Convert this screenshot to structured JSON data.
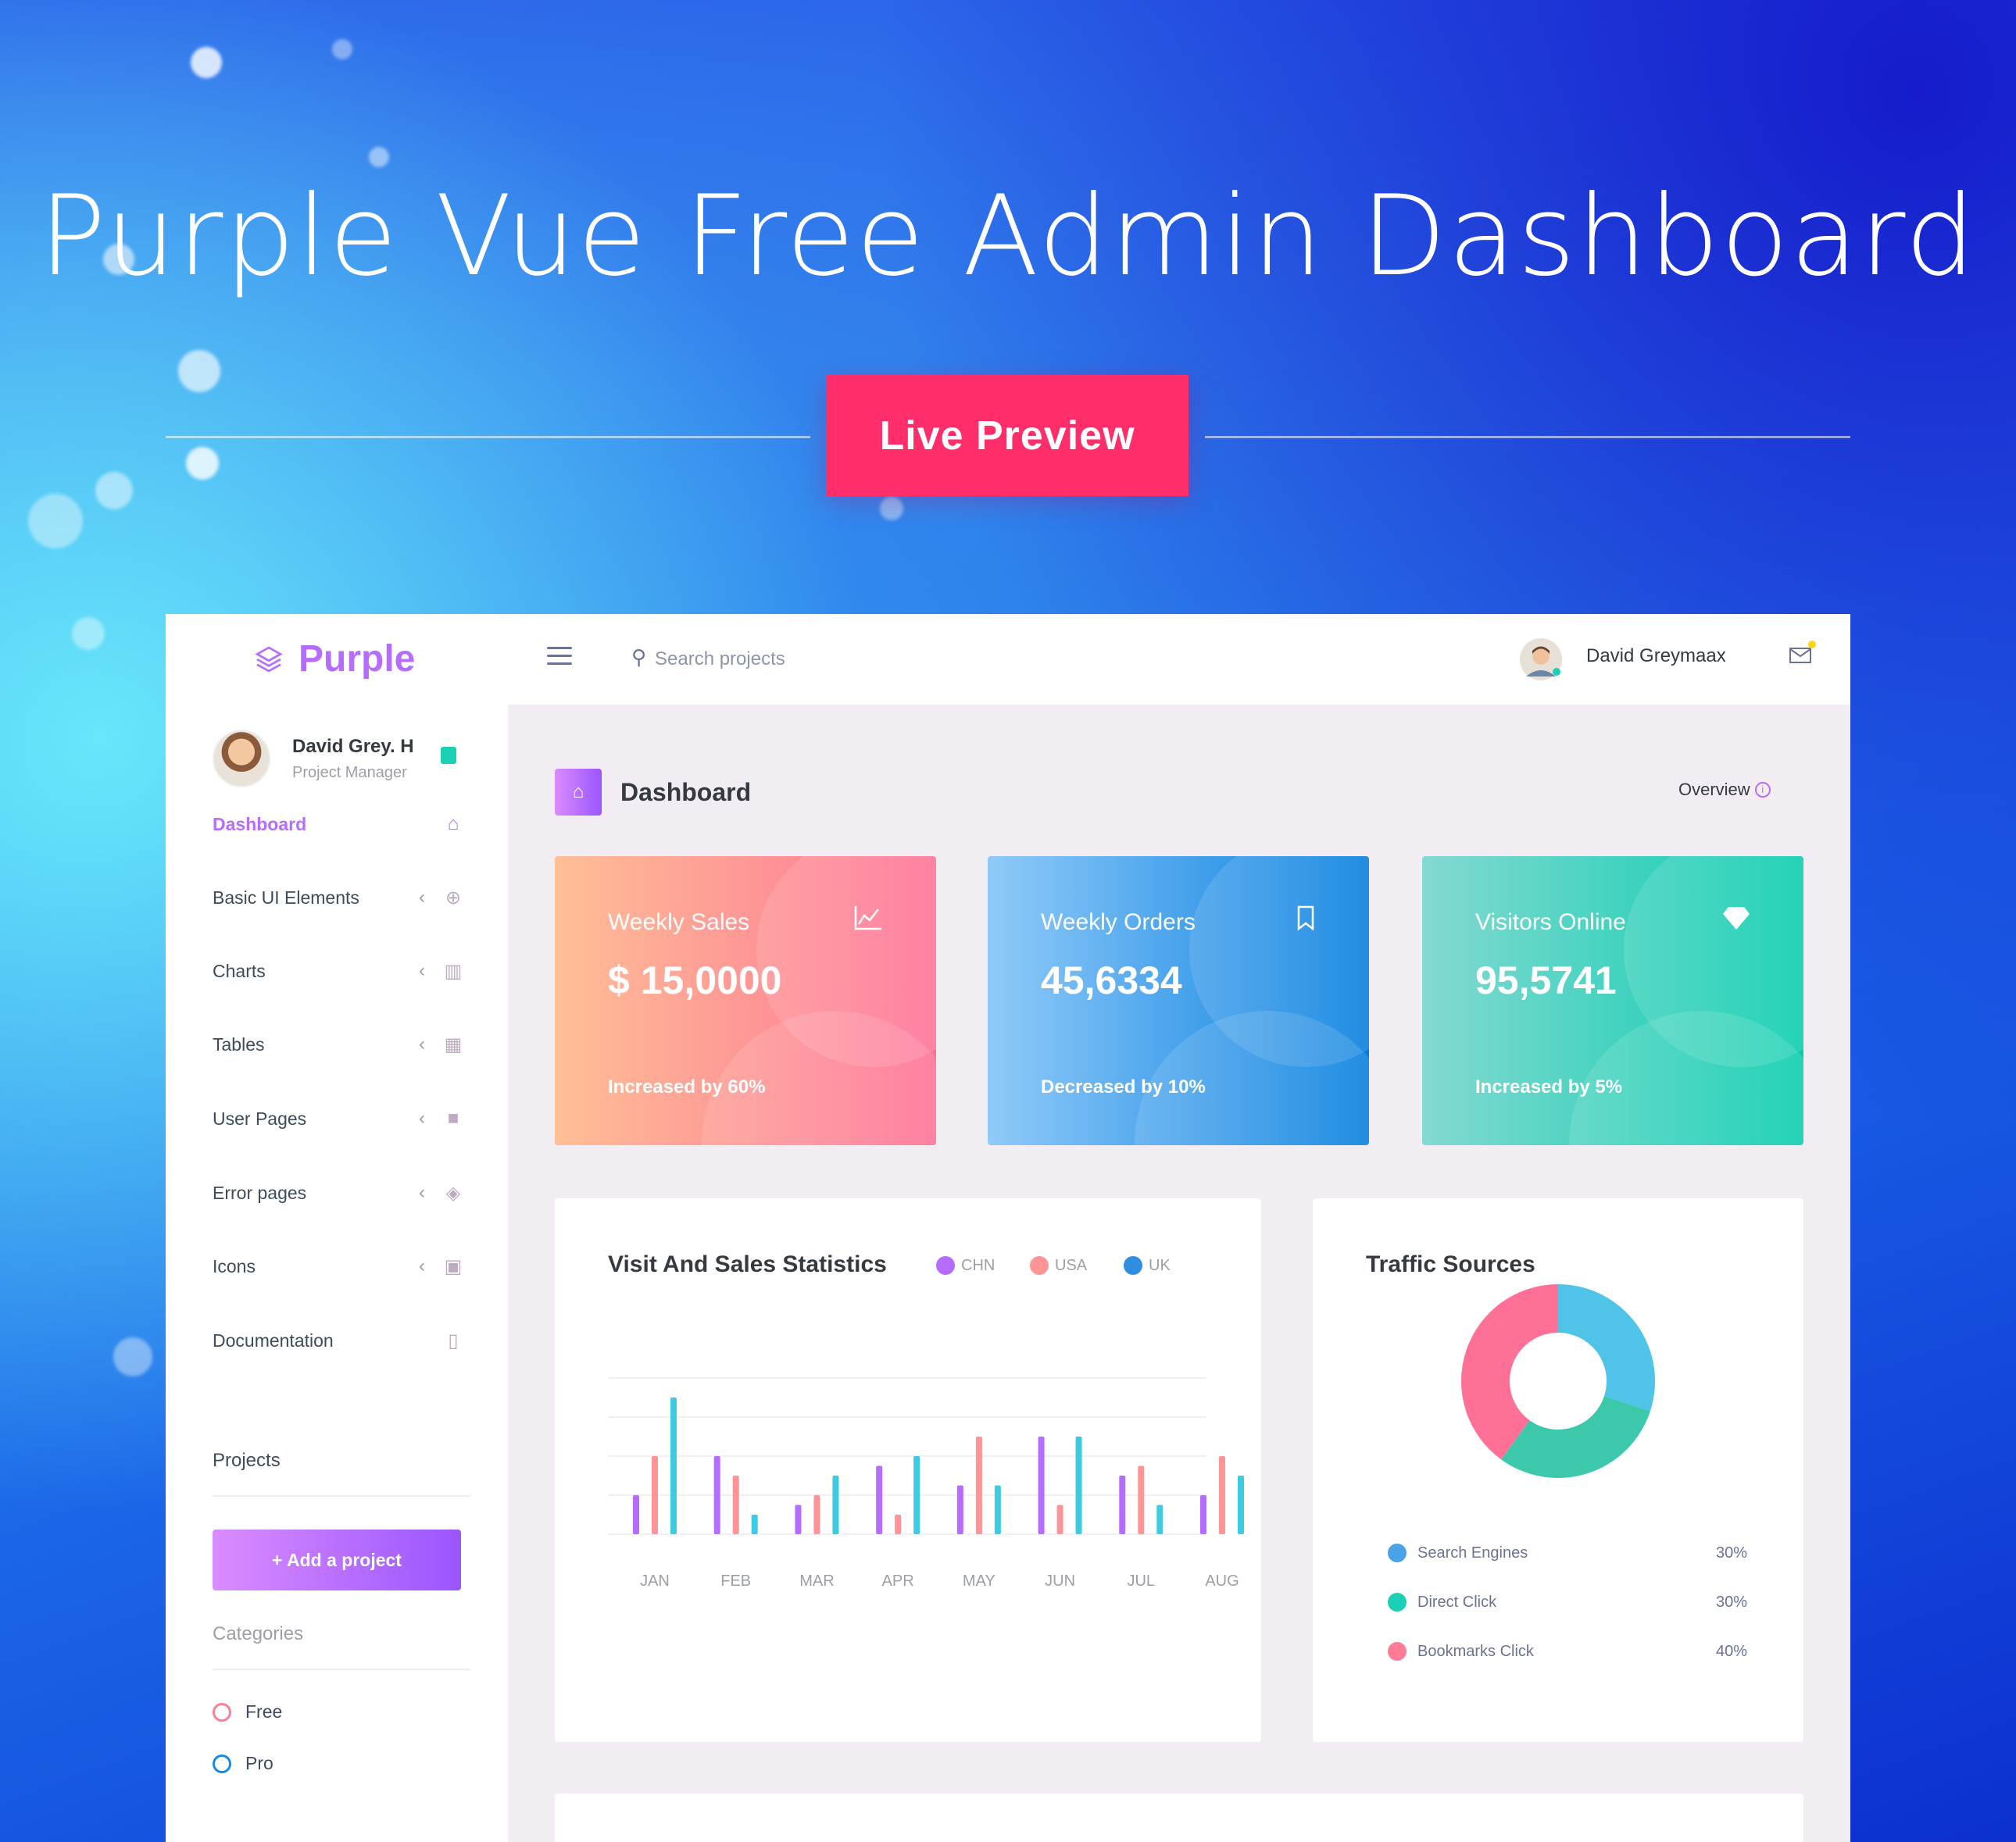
{
  "hero": {
    "headline": "Purple Vue Free Admin Dashboard",
    "cta_label": "Live Preview"
  },
  "brand": {
    "name": "Purple"
  },
  "profile": {
    "name": "David Grey. H",
    "role": "Project Manager"
  },
  "nav": [
    {
      "label": "Dashboard",
      "icon": "home-icon",
      "active": true,
      "expandable": false
    },
    {
      "label": "Basic UI Elements",
      "icon": "crosshairs-icon",
      "expandable": true
    },
    {
      "label": "Charts",
      "icon": "chart-bar-icon",
      "expandable": true
    },
    {
      "label": "Tables",
      "icon": "table-icon",
      "expandable": true
    },
    {
      "label": "User Pages",
      "icon": "lock-icon",
      "expandable": true
    },
    {
      "label": "Error pages",
      "icon": "shield-icon",
      "expandable": true
    },
    {
      "label": "Icons",
      "icon": "contacts-icon",
      "expandable": true
    },
    {
      "label": "Documentation",
      "icon": "document-icon",
      "expandable": false
    }
  ],
  "projects": {
    "title": "Projects",
    "add_label": "+ Add a project"
  },
  "categories": {
    "title": "Categories",
    "items": [
      {
        "label": "Free",
        "color": "#fe7c96"
      },
      {
        "label": "Pro",
        "color": "#198ae3"
      }
    ]
  },
  "topbar": {
    "search_placeholder": "Search projects",
    "user_name": "David Greymaax"
  },
  "page": {
    "title": "Dashboard",
    "overview_label": "Overview"
  },
  "stats": [
    {
      "title": "Weekly Sales",
      "value": "$ 15,0000",
      "sub": "Increased by 60%",
      "icon": "chart-line-icon",
      "gradient": [
        "#ffbf96",
        "#fe7096"
      ]
    },
    {
      "title": "Weekly Orders",
      "value": "45,6334",
      "sub": "Decreased by 10%",
      "icon": "bookmark-icon",
      "gradient": [
        "#90caf9",
        "#047edf"
      ]
    },
    {
      "title": "Visitors Online",
      "value": "95,5741",
      "sub": "Increased by 5%",
      "icon": "diamond-icon",
      "gradient": [
        "#84d9d2",
        "#07cdae"
      ]
    }
  ],
  "visits": {
    "title": "Visit And Sales Statistics",
    "legend": [
      {
        "label": "CHN",
        "color": "#b66dff"
      },
      {
        "label": "USA",
        "color": "#fe9496"
      },
      {
        "label": "UK",
        "color": "#2f8ee0"
      }
    ]
  },
  "traffic": {
    "title": "Traffic Sources",
    "rows": [
      {
        "label": "Search Engines",
        "pct": "30%",
        "color": "#4aa3e6"
      },
      {
        "label": "Direct Click",
        "pct": "30%",
        "color": "#1bcfb4"
      },
      {
        "label": "Bookmarks Click",
        "pct": "40%",
        "color": "#fe7c96"
      }
    ]
  },
  "chart_data": [
    {
      "type": "bar",
      "title": "Visit And Sales Statistics",
      "categories": [
        "JAN",
        "FEB",
        "MAR",
        "APR",
        "MAY",
        "JUN",
        "JUL",
        "AUG"
      ],
      "series": [
        {
          "name": "CHN",
          "color": "#b66dff",
          "values": [
            20,
            40,
            15,
            35,
            25,
            50,
            30,
            20
          ]
        },
        {
          "name": "USA",
          "color": "#fe9496",
          "values": [
            40,
            30,
            20,
            10,
            50,
            15,
            35,
            40
          ]
        },
        {
          "name": "UK",
          "color": "#3ccbe0",
          "values": [
            70,
            10,
            30,
            40,
            25,
            50,
            15,
            30
          ]
        }
      ],
      "ylim": [
        0,
        80
      ],
      "grid": true
    },
    {
      "type": "pie",
      "title": "Traffic Sources",
      "labels": [
        "Search Engines",
        "Direct Click",
        "Bookmarks Click"
      ],
      "values": [
        30,
        30,
        40
      ],
      "colors": [
        "#4fc3e8",
        "#3cc9ab",
        "#fe7096"
      ]
    }
  ]
}
